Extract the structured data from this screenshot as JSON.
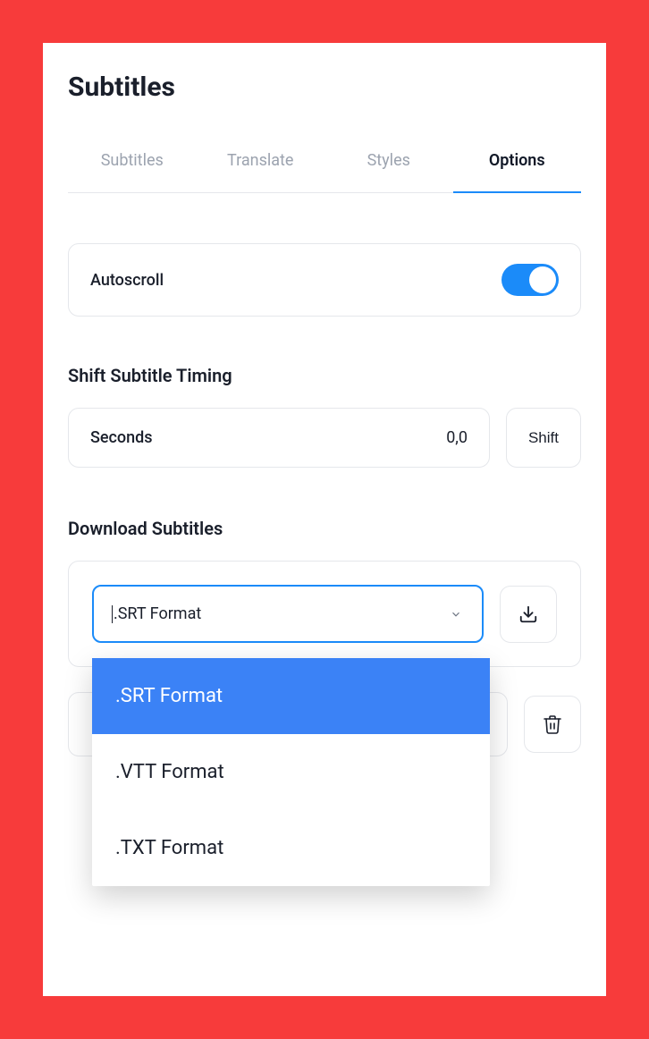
{
  "title": "Subtitles",
  "tabs": [
    {
      "label": "Subtitles"
    },
    {
      "label": "Translate"
    },
    {
      "label": "Styles"
    },
    {
      "label": "Options"
    }
  ],
  "autoscroll": {
    "label": "Autoscroll",
    "on": true
  },
  "shift": {
    "heading": "Shift Subtitle Timing",
    "seconds_label": "Seconds",
    "seconds_value": "0,0",
    "button": "Shift"
  },
  "download": {
    "heading": "Download Subtitles",
    "selected": ".SRT Format",
    "options": [
      ".SRT Format",
      ".VTT Format",
      ".TXT Format"
    ]
  }
}
